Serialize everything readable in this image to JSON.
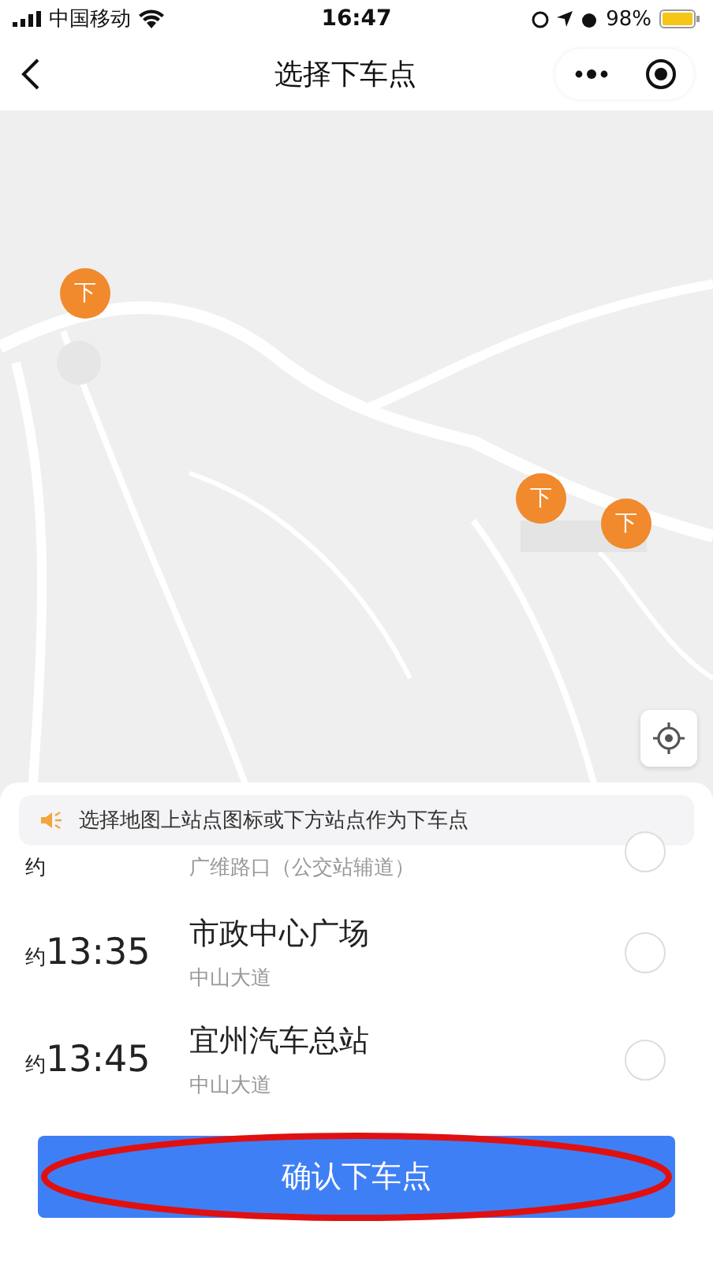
{
  "status_bar": {
    "carrier": "中国移动",
    "time": "16:47",
    "battery": "98%"
  },
  "nav": {
    "title": "选择下车点"
  },
  "map": {
    "pins": [
      {
        "label": "下"
      },
      {
        "label": "下"
      },
      {
        "label": "下"
      }
    ]
  },
  "notice": {
    "text": "选择地图上站点图标或下方站点作为下车点"
  },
  "stops": [
    {
      "time_prefix": "约",
      "address": "广维路口（公交站辅道）",
      "selected": false
    },
    {
      "time_prefix": "约",
      "time": "13:35",
      "name": "市政中心广场",
      "address": "中山大道",
      "selected": false
    },
    {
      "time_prefix": "约",
      "time": "13:45",
      "name": "宜州汽车总站",
      "address": "中山大道",
      "selected": false
    }
  ],
  "confirm_button": {
    "label": "确认下车点",
    "highlighted": true
  }
}
